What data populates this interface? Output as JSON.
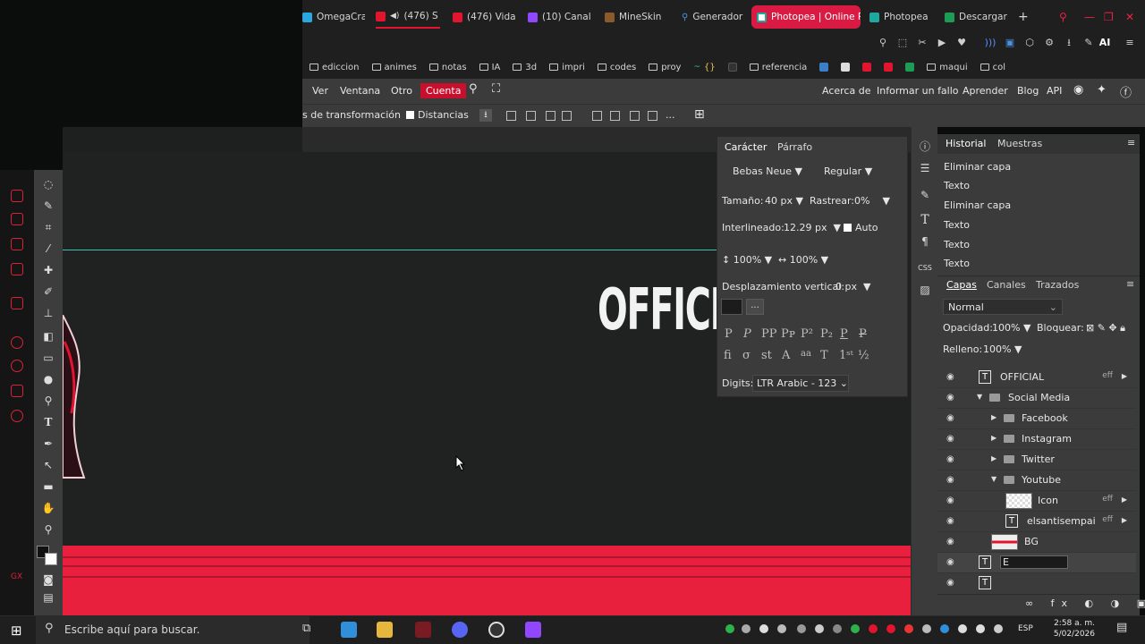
{
  "browser": {
    "tabs": [
      {
        "label": "OmegaCra",
        "color": "#2aa6e0"
      },
      {
        "label": "(476) S",
        "color": "#e3142d"
      },
      {
        "label": "(476) Vida",
        "color": "#e3142d"
      },
      {
        "label": "(10) Canal",
        "color": "#9146ff"
      },
      {
        "label": "MineSkin",
        "color": "#8a5a2b"
      },
      {
        "label": "Generador",
        "color": "#4a90e2"
      },
      {
        "label": "Photopea | Online P",
        "color": "#ffffff"
      },
      {
        "label": "Photopea",
        "color": "#1fa8a0"
      },
      {
        "label": "Descargar",
        "color": "#1d9c55"
      }
    ],
    "new_tab": "+",
    "ai_label": "AI",
    "bookmarks": [
      {
        "label": "ediccion"
      },
      {
        "label": "animes"
      },
      {
        "label": "notas"
      },
      {
        "label": "IA"
      },
      {
        "label": "3d"
      },
      {
        "label": "impri"
      },
      {
        "label": "codes"
      },
      {
        "label": "proy"
      },
      {
        "label": "{}"
      },
      {
        "label": "referencia"
      },
      {
        "label": "maqui"
      },
      {
        "label": "col"
      }
    ]
  },
  "menubar": {
    "items": [
      "Ver",
      "Ventana",
      "Otro"
    ],
    "account": "Cuenta",
    "right_links": [
      "Acerca de",
      "Informar un fallo",
      "Aprender",
      "Blog",
      "API"
    ]
  },
  "options": {
    "transform_label": "s de transformación",
    "distances_label": "Distancias",
    "more": "..."
  },
  "canvas": {
    "headline": "OFFICI"
  },
  "character_panel": {
    "tab_character": "Carácter",
    "tab_paragraph": "Párrafo",
    "font": "Bebas Neue",
    "style": "Regular",
    "size_label": "Tamaño:",
    "size_value": "40 px",
    "tracking_label": "Rastrear:",
    "tracking_value": "0%",
    "leading_label": "Interlineado:",
    "leading_value": "12.29 px",
    "auto_label": "Auto",
    "vscale": "100%",
    "hscale": "100%",
    "baseline_label": "Desplazamiento vertical:",
    "baseline_value": "0 px",
    "more": "...",
    "digits_label": "Digits:",
    "digits_value": "LTR Arabic - 123"
  },
  "history_panel": {
    "tab_history": "Historial",
    "tab_swatches": "Muestras",
    "rows": [
      "Eliminar capa",
      "Texto",
      "Eliminar capa",
      "Texto",
      "Texto",
      "Texto"
    ]
  },
  "layers_panel": {
    "tab_layers": "Capas",
    "tab_channels": "Canales",
    "tab_paths": "Trazados",
    "blend_mode": "Normal",
    "opacity_label": "Opacidad:",
    "opacity_value": "100%",
    "lock_label": "Bloquear:",
    "fill_label": "Relleno:",
    "fill_value": "100%",
    "fx_label": "eff",
    "layers": [
      {
        "name": "OFFICIAL"
      },
      {
        "name": "Social Media"
      },
      {
        "name": "Facebook"
      },
      {
        "name": "Instagram"
      },
      {
        "name": "Twitter"
      },
      {
        "name": "Youtube"
      },
      {
        "name": "Icon"
      },
      {
        "name": "elsantisempai"
      },
      {
        "name": "BG"
      },
      {
        "name": "E"
      }
    ]
  },
  "taskbar": {
    "search_placeholder": "Escribe aquí para buscar.",
    "lang": "ESP",
    "time": "2:58 a. m.",
    "date": "5/02/2026"
  }
}
